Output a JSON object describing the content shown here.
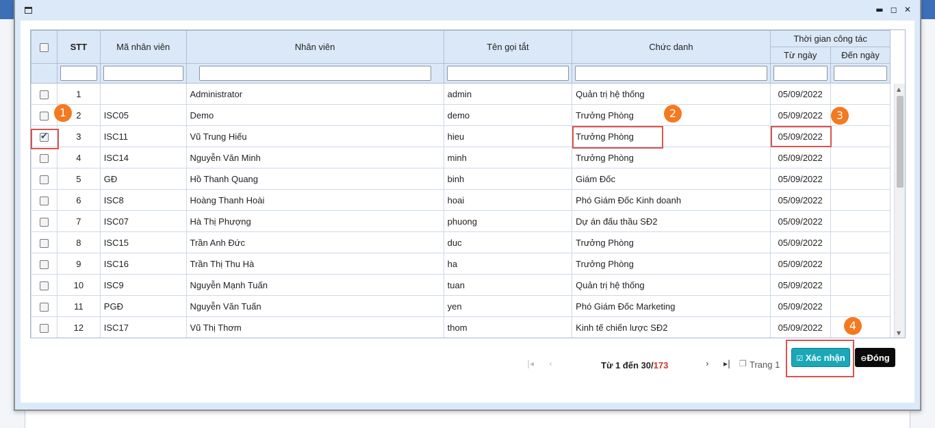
{
  "window": {
    "controls": "▬ ◻ ✕"
  },
  "table": {
    "columns": {
      "stt": "STT",
      "ma_nhan_vien": "Mã nhân viên",
      "nhan_vien": "Nhân viên",
      "ten_goi_tat": "Tên gọi tắt",
      "chuc_danh": "Chức danh",
      "thoi_gian": "Thời gian công tác",
      "tu_ngay": "Từ ngày",
      "den_ngay": "Đến ngày"
    },
    "rows": [
      {
        "stt": "1",
        "ma": "",
        "ten": "Administrator",
        "tat": "admin",
        "chuc": "Quản trị hệ thống",
        "tu": "05/09/2022",
        "den": "",
        "checked": false
      },
      {
        "stt": "2",
        "ma": "ISC05",
        "ten": "Demo",
        "tat": "demo",
        "chuc": "Trưởng Phòng",
        "tu": "05/09/2022",
        "den": "",
        "checked": false
      },
      {
        "stt": "3",
        "ma": "ISC11",
        "ten": "Vũ Trung Hiếu",
        "tat": "hieu",
        "chuc": "Trưởng Phòng",
        "tu": "05/09/2022",
        "den": "",
        "checked": true
      },
      {
        "stt": "4",
        "ma": "ISC14",
        "ten": "Nguyễn Văn Minh",
        "tat": "minh",
        "chuc": "Trưởng Phòng",
        "tu": "05/09/2022",
        "den": "",
        "checked": false
      },
      {
        "stt": "5",
        "ma": "GĐ",
        "ten": "Hồ Thanh Quang",
        "tat": "binh",
        "chuc": "Giám Đốc",
        "tu": "05/09/2022",
        "den": "",
        "checked": false
      },
      {
        "stt": "6",
        "ma": "ISC8",
        "ten": "Hoàng Thanh Hoài",
        "tat": "hoai",
        "chuc": "Phó Giám Đốc Kinh doanh",
        "tu": "05/09/2022",
        "den": "",
        "checked": false
      },
      {
        "stt": "7",
        "ma": "ISC07",
        "ten": "Hà Thị Phượng",
        "tat": "phuong",
        "chuc": "Dự án đấu thầu SĐ2",
        "tu": "05/09/2022",
        "den": "",
        "checked": false
      },
      {
        "stt": "8",
        "ma": "ISC15",
        "ten": "Trần Anh Đức",
        "tat": "duc",
        "chuc": "Trưởng Phòng",
        "tu": "05/09/2022",
        "den": "",
        "checked": false
      },
      {
        "stt": "9",
        "ma": "ISC16",
        "ten": "Trần Thị Thu Hà",
        "tat": "ha",
        "chuc": "Trưởng Phòng",
        "tu": "05/09/2022",
        "den": "",
        "checked": false
      },
      {
        "stt": "10",
        "ma": "ISC9",
        "ten": "Nguyễn Mạnh Tuấn",
        "tat": "tuan",
        "chuc": "Quản trị hệ thống",
        "tu": "05/09/2022",
        "den": "",
        "checked": false
      },
      {
        "stt": "11",
        "ma": "PGĐ",
        "ten": "Nguyễn Văn Tuấn",
        "tat": "yen",
        "chuc": "Phó Giám Đốc Marketing",
        "tu": "05/09/2022",
        "den": "",
        "checked": false
      },
      {
        "stt": "12",
        "ma": "ISC17",
        "ten": "Vũ Thị Thơm",
        "tat": "thom",
        "chuc": "Kinh tế chiến lược SĐ2",
        "tu": "05/09/2022",
        "den": "",
        "checked": false
      }
    ]
  },
  "pager": {
    "range": "Từ 1 đến 30/",
    "total": "173",
    "page_label": "Trang 1"
  },
  "buttons": {
    "confirm": "Xác nhận",
    "close": "Đóng"
  },
  "badges": [
    "1",
    "2",
    "3",
    "4"
  ],
  "colors": {
    "accent": "#1aa8b8",
    "highlight": "#d9534f",
    "badge": "#f47920"
  }
}
